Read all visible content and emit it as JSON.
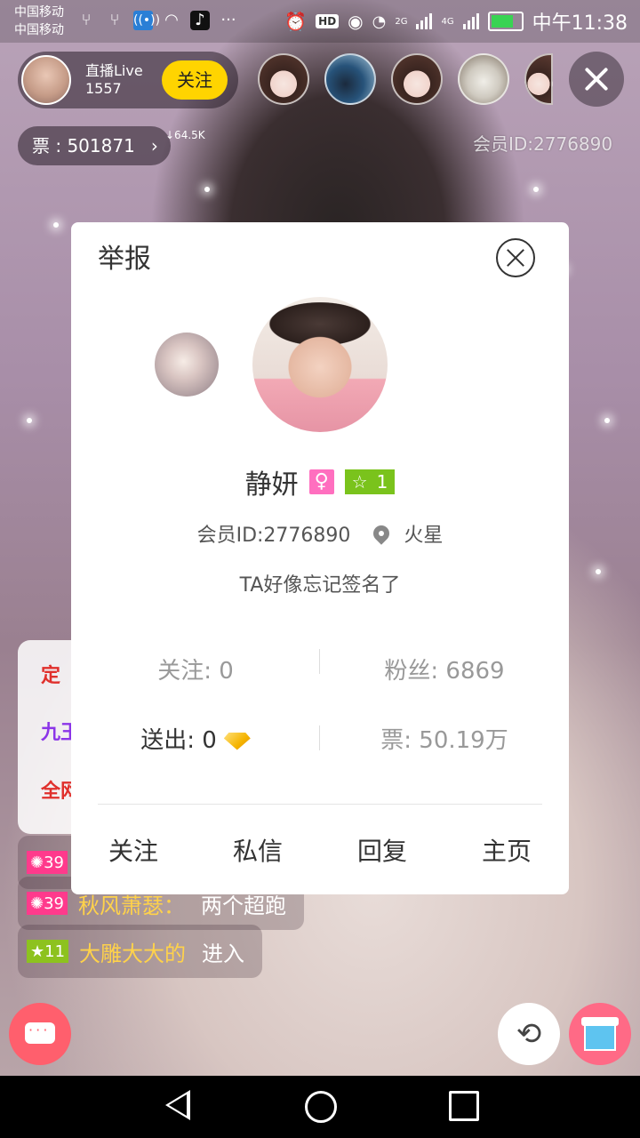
{
  "status_bar": {
    "carrier_1": "中国移动",
    "carrier_2": "中国移动",
    "net_2g": "2G",
    "net_4g": "4G",
    "time": "中午11:38"
  },
  "top_bar": {
    "host_name": "直播Live",
    "host_count": "1557",
    "follow_label": "关注",
    "tickets_label": "票 : 501871",
    "speed": "↓64.5K",
    "member_id": "会员ID:2776890"
  },
  "modal": {
    "title": "举报",
    "username": "静妍",
    "level": "1",
    "member_id": "会员ID:2776890",
    "location": "火星",
    "signature": "TA好像忘记签名了",
    "stats": {
      "following": "关注: 0",
      "fans": "粉丝: 6869",
      "sent": "送出: 0",
      "tickets": "票: 50.19万"
    },
    "actions": [
      "关注",
      "私信",
      "回复",
      "主页"
    ]
  },
  "chat": {
    "box_line_1": "定",
    "box_line_2": "九王",
    "box_line_3": "全网",
    "lines": [
      {
        "level": "39",
        "level_color": "#ff3a8c",
        "user": "",
        "msg": ""
      },
      {
        "level": "39",
        "level_color": "#ff3a8c",
        "user": "秋风萧瑟：",
        "msg": "两个超跑"
      },
      {
        "level": "11",
        "level_color": "#8dc21f",
        "user": "大雕大大的",
        "msg": "进入"
      }
    ]
  },
  "colors": {
    "follow_yellow": "#ffd400",
    "gift_pink": "#ff6a86",
    "level_green": "#7ac31c",
    "gender_pink": "#ff6fbf"
  }
}
